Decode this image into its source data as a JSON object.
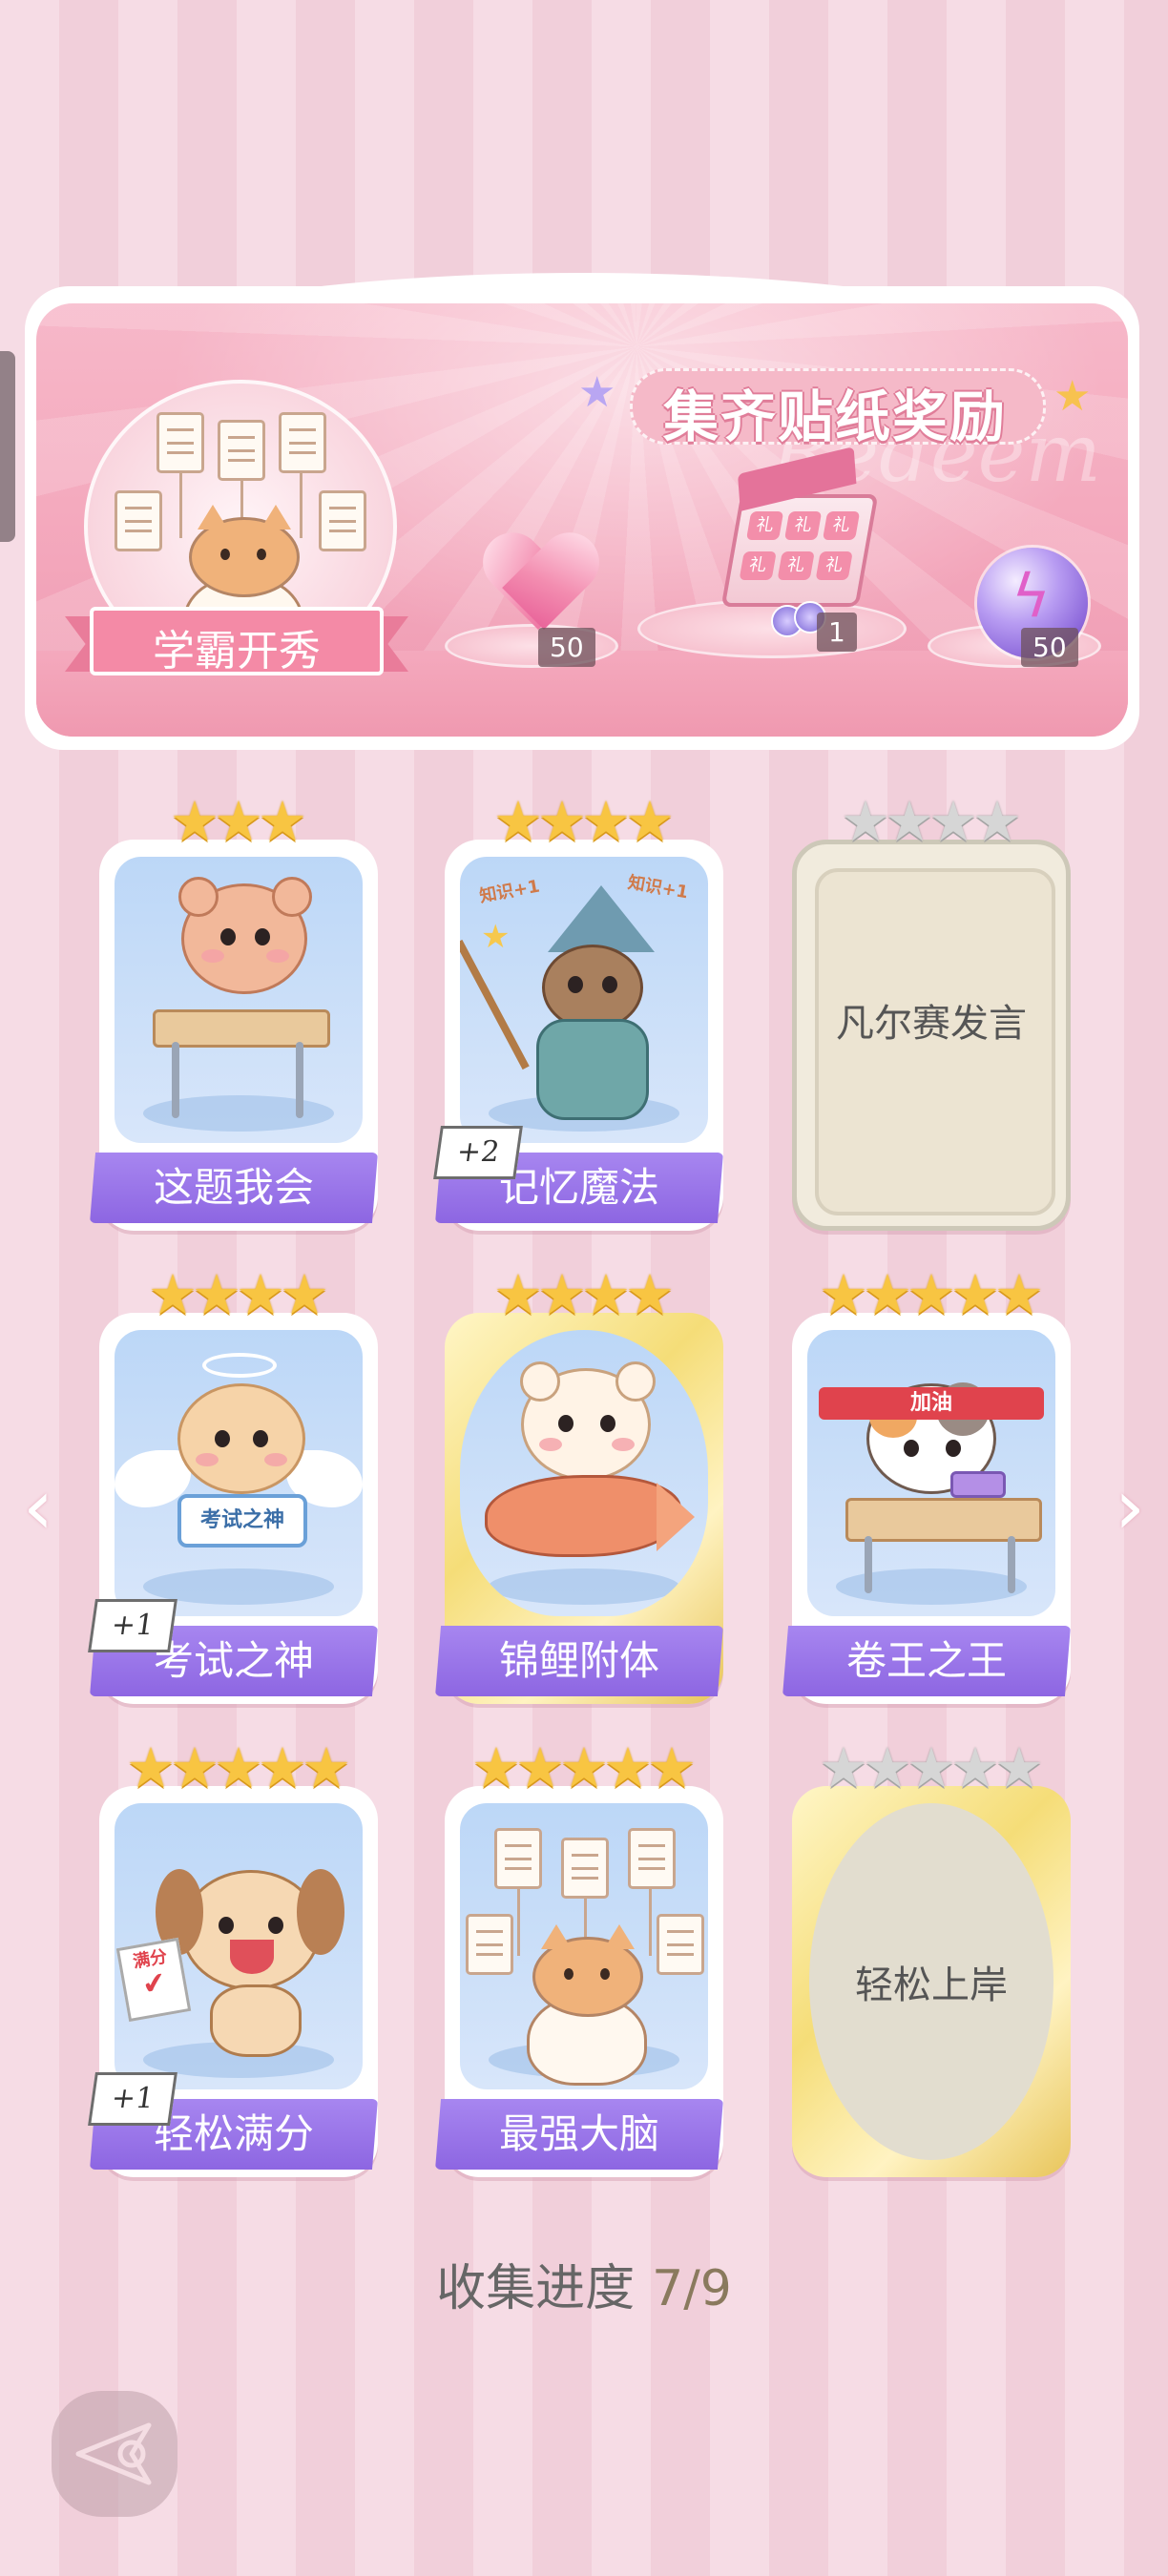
{
  "banner": {
    "title": "集齐贴纸奖励",
    "watermark": "Redeem",
    "featured_sticker_label": "学霸开秀",
    "rewards": [
      {
        "icon": "pink-heart-gem-icon",
        "count": "50"
      },
      {
        "icon": "gift-box-icon",
        "count": "1",
        "box_char": "礼"
      },
      {
        "icon": "purple-energy-orb-icon",
        "count": "50"
      }
    ]
  },
  "stickers": [
    {
      "name": "这题我会",
      "stars": 3,
      "max_stars": 3,
      "collected": true,
      "badge": ""
    },
    {
      "name": "记忆魔法",
      "stars": 4,
      "max_stars": 4,
      "collected": true,
      "badge": "+2",
      "art_text": "知识+1"
    },
    {
      "name": "凡尔赛发言",
      "stars": 0,
      "max_stars": 4,
      "collected": false,
      "badge": ""
    },
    {
      "name": "考试之神",
      "stars": 4,
      "max_stars": 4,
      "collected": true,
      "badge": "+1",
      "art_text": "考试之神"
    },
    {
      "name": "锦鲤附体",
      "stars": 4,
      "max_stars": 4,
      "collected": true,
      "badge": ""
    },
    {
      "name": "卷王之王",
      "stars": 5,
      "max_stars": 5,
      "collected": true,
      "badge": "",
      "art_text": "加油"
    },
    {
      "name": "轻松满分",
      "stars": 5,
      "max_stars": 5,
      "collected": true,
      "badge": "+1",
      "art_text": "满分"
    },
    {
      "name": "最强大脑",
      "stars": 5,
      "max_stars": 5,
      "collected": true,
      "badge": ""
    },
    {
      "name": "轻松上岸",
      "stars": 0,
      "max_stars": 5,
      "collected": false,
      "badge": ""
    }
  ],
  "progress": {
    "label": "收集进度",
    "value": "7/9",
    "collected": 7,
    "total": 9
  },
  "colors": {
    "name_bar": "#8d66e2",
    "star_gold": "#f8c542",
    "star_grey": "#d6d6d6",
    "background": "#f6dce5"
  }
}
